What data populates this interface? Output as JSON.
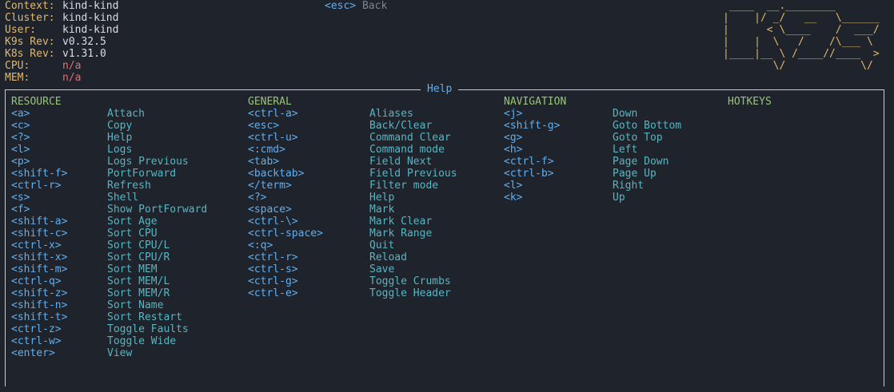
{
  "header": {
    "info": [
      {
        "label": "Context:",
        "value": "kind-kind"
      },
      {
        "label": "Cluster:",
        "value": "kind-kind"
      },
      {
        "label": "User:",
        "value": "kind-kind"
      },
      {
        "label": "K9s Rev:",
        "value": "v0.32.5"
      },
      {
        "label": "K8s Rev:",
        "value": "v1.31.0"
      },
      {
        "label": "CPU:",
        "value": "n/a"
      },
      {
        "label": "MEM:",
        "value": "n/a"
      }
    ],
    "crumb_key": "<esc>",
    "crumb_action": "Back",
    "logo": " ____  __.________\n|    |/ _/   __   \\______\n|      < \\____    /  ___/\n|    |  \\   /    /\\___ \\\n|____|__ \\ /____//____  >\n        \\/            \\/"
  },
  "help": {
    "title": "Help",
    "sections": [
      {
        "title": "RESOURCE",
        "items": [
          {
            "key": "<a>",
            "desc": "Attach"
          },
          {
            "key": "<c>",
            "desc": "Copy"
          },
          {
            "key": "<?>",
            "desc": "Help"
          },
          {
            "key": "<l>",
            "desc": "Logs"
          },
          {
            "key": "<p>",
            "desc": "Logs Previous"
          },
          {
            "key": "<shift-f>",
            "desc": "PortForward"
          },
          {
            "key": "<ctrl-r>",
            "desc": "Refresh"
          },
          {
            "key": "<s>",
            "desc": "Shell"
          },
          {
            "key": "<f>",
            "desc": "Show PortForward"
          },
          {
            "key": "<shift-a>",
            "desc": "Sort Age"
          },
          {
            "key": "<shift-c>",
            "desc": "Sort CPU"
          },
          {
            "key": "<ctrl-x>",
            "desc": "Sort CPU/L"
          },
          {
            "key": "<shift-x>",
            "desc": "Sort CPU/R"
          },
          {
            "key": "<shift-m>",
            "desc": "Sort MEM"
          },
          {
            "key": "<ctrl-q>",
            "desc": "Sort MEM/L"
          },
          {
            "key": "<shift-z>",
            "desc": "Sort MEM/R"
          },
          {
            "key": "<shift-n>",
            "desc": "Sort Name"
          },
          {
            "key": "<shift-t>",
            "desc": "Sort Restart"
          },
          {
            "key": "<ctrl-z>",
            "desc": "Toggle Faults"
          },
          {
            "key": "<ctrl-w>",
            "desc": "Toggle Wide"
          },
          {
            "key": "<enter>",
            "desc": "View"
          }
        ]
      },
      {
        "title": "GENERAL",
        "items": [
          {
            "key": "<ctrl-a>",
            "desc": "Aliases"
          },
          {
            "key": "<esc>",
            "desc": "Back/Clear"
          },
          {
            "key": "<ctrl-u>",
            "desc": "Command Clear"
          },
          {
            "key": "<:cmd>",
            "desc": "Command mode"
          },
          {
            "key": "<tab>",
            "desc": "Field Next"
          },
          {
            "key": "<backtab>",
            "desc": "Field Previous"
          },
          {
            "key": "</term>",
            "desc": "Filter mode"
          },
          {
            "key": "<?>",
            "desc": "Help"
          },
          {
            "key": "<space>",
            "desc": "Mark"
          },
          {
            "key": "<ctrl-\\>",
            "desc": "Mark Clear"
          },
          {
            "key": "<ctrl-space>",
            "desc": "Mark Range"
          },
          {
            "key": "<:q>",
            "desc": "Quit"
          },
          {
            "key": "<ctrl-r>",
            "desc": "Reload"
          },
          {
            "key": "<ctrl-s>",
            "desc": "Save"
          },
          {
            "key": "<ctrl-g>",
            "desc": "Toggle Crumbs"
          },
          {
            "key": "<ctrl-e>",
            "desc": "Toggle Header"
          }
        ]
      },
      {
        "title": "NAVIGATION",
        "items": [
          {
            "key": "<j>",
            "desc": "Down"
          },
          {
            "key": "<shift-g>",
            "desc": "Goto Bottom"
          },
          {
            "key": "<g>",
            "desc": "Goto Top"
          },
          {
            "key": "<h>",
            "desc": "Left"
          },
          {
            "key": "<ctrl-f>",
            "desc": "Page Down"
          },
          {
            "key": "<ctrl-b>",
            "desc": "Page Up"
          },
          {
            "key": "<l>",
            "desc": "Right"
          },
          {
            "key": "<k>",
            "desc": "Up"
          }
        ]
      },
      {
        "title": "HOTKEYS",
        "items": []
      }
    ]
  }
}
